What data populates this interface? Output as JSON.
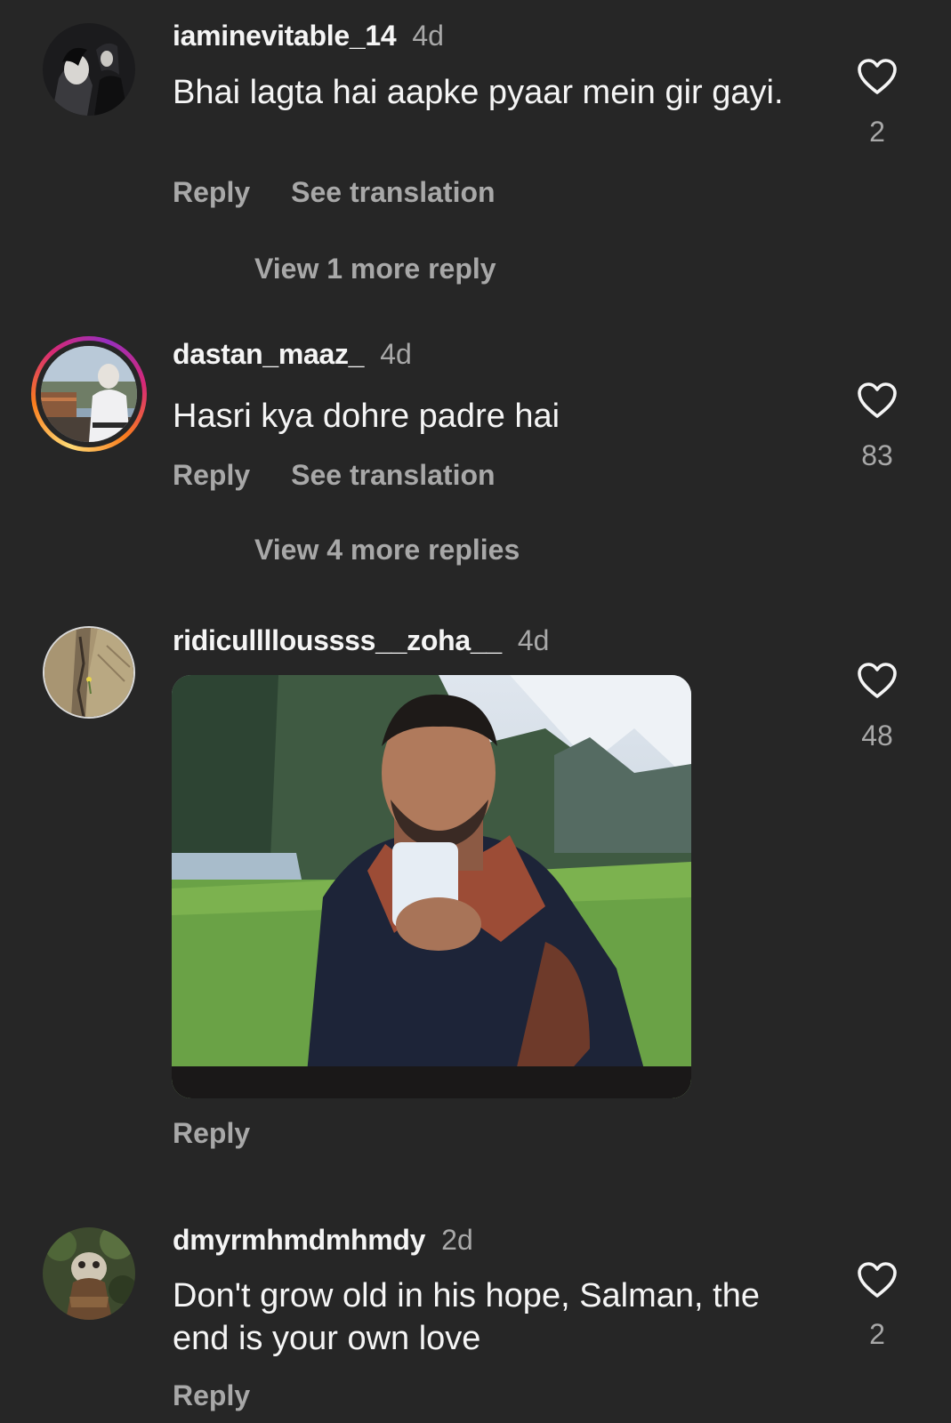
{
  "comments": [
    {
      "username": "iaminevitable_14",
      "time": "4d",
      "text": "Bhai lagta hai aapke pyaar mein gir gayi.",
      "reply_label": "Reply",
      "translate_label": "See translation",
      "view_more": "View 1 more reply",
      "likes": "2"
    },
    {
      "username": "dastan_maaz_",
      "time": "4d",
      "text": "Hasri kya dohre padre hai",
      "reply_label": "Reply",
      "translate_label": "See translation",
      "view_more": "View 4 more replies",
      "likes": "83"
    },
    {
      "username": "ridiculllloussss__zoha__",
      "time": "4d",
      "reply_label": "Reply",
      "likes": "48"
    },
    {
      "username": "dmyrmhmdmhmdy",
      "time": "2d",
      "text": "Don't grow old in his hope, Salman, the end is your own love",
      "reply_label": "Reply",
      "likes": "2"
    }
  ],
  "icons": {
    "like": "heart-outline-icon"
  },
  "colors": {
    "background": "#262626",
    "primary_text": "#f5f5f5",
    "secondary_text": "#a8a8a8",
    "story_ring": [
      "#feda75",
      "#fa7e1e",
      "#d62976",
      "#962fbf"
    ]
  }
}
